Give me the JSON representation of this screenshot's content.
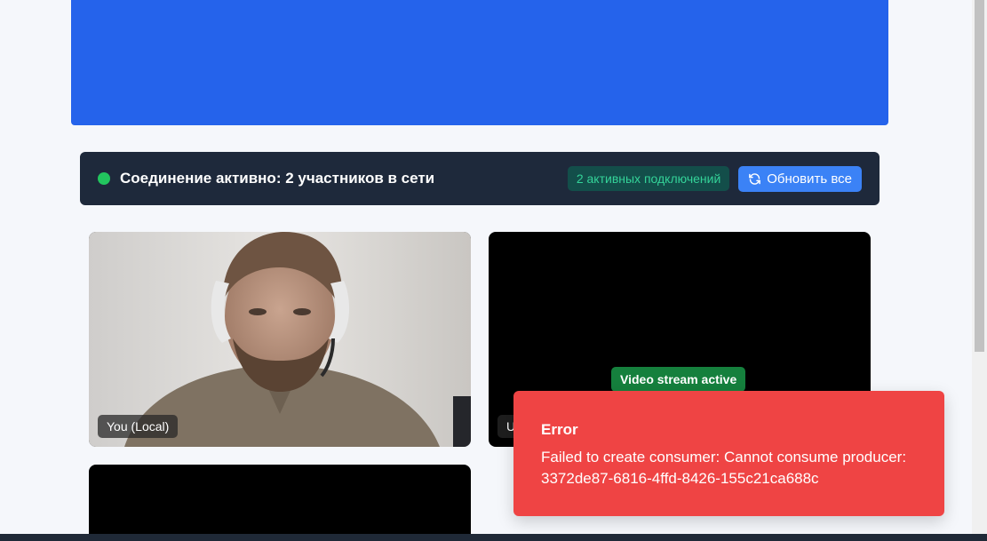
{
  "status_bar": {
    "text": "Соединение активно: 2 участников в сети",
    "connections_badge": "2 активных подключений",
    "refresh_label": "Обновить все"
  },
  "tiles": {
    "local_label": "You (Local)",
    "remote_label": "U",
    "stream_badge": "Video stream active"
  },
  "toast": {
    "title": "Error",
    "message": "Failed to create consumer: Cannot consume producer: 3372de87-6816-4ffd-8426-155c21ca688c"
  },
  "icons": {
    "status": "status-dot-icon",
    "refresh": "refresh-icon"
  },
  "colors": {
    "banner": "#2563eb",
    "status_bar": "#1e293b",
    "online": "#22c55e",
    "badge_text": "#34d399",
    "refresh_button": "#3b82f6",
    "stream_badge": "#15803d",
    "error": "#ef4444"
  }
}
